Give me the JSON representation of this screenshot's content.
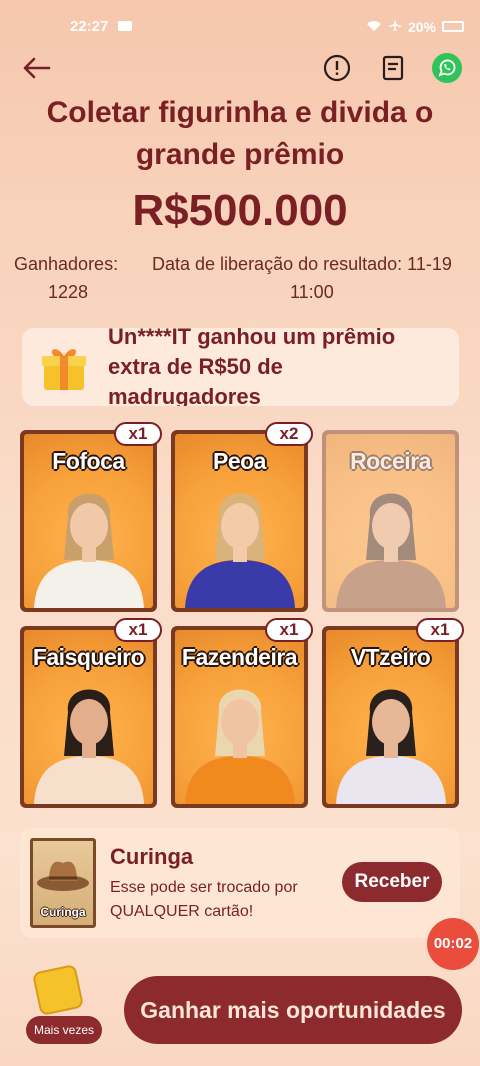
{
  "status_bar": {
    "time": "22:27",
    "battery": "20%"
  },
  "header": {
    "title_line1": "Coletar figurinha e divida o",
    "title_line2": "grande prêmio",
    "prize": "R$500.000"
  },
  "stats": {
    "winners_label": "Ganhadores:",
    "winners_value": "1228",
    "release_label": "Data de liberação do resultado: 11-19",
    "release_time": "11:00"
  },
  "notice": {
    "line1": "Un****IT ganhou um prêmio",
    "line2": "extra de R$50 de",
    "line3": "madrugadores"
  },
  "cards": [
    {
      "name": "Fofoca",
      "count": "x1",
      "owned": true,
      "shirt": "#f4f0ea",
      "hair": "#c9a06a",
      "skin": "#f2c9a8"
    },
    {
      "name": "Peoa",
      "count": "x2",
      "owned": true,
      "shirt": "#3a3aa8",
      "hair": "#d9b37a",
      "skin": "#f3cba9"
    },
    {
      "name": "Roceira",
      "count": "",
      "owned": false,
      "shirt": "#8a5a3c",
      "hair": "#3a2a22",
      "skin": "#e6b895"
    },
    {
      "name": "Faisqueiro",
      "count": "x1",
      "owned": true,
      "shirt": "#f6e0cc",
      "hair": "#2a1e18",
      "skin": "#e3ae8c"
    },
    {
      "name": "Fazendeira",
      "count": "x1",
      "owned": true,
      "shirt": "#f08a1e",
      "hair": "#e9d7b0",
      "skin": "#f0c4a2"
    },
    {
      "name": "VTzeiro",
      "count": "x1",
      "owned": true,
      "shirt": "#e9e6ef",
      "hair": "#2a201c",
      "skin": "#e7b898"
    }
  ],
  "wildcard": {
    "card_label": "Curinga",
    "title": "Curinga",
    "description": "Esse pode ser trocado por QUALQUER cartão!",
    "button": "Receber"
  },
  "timer": "00:02",
  "bottom": {
    "more_label": "Mais vezes",
    "cta": "Ganhar mais oportunidades"
  }
}
